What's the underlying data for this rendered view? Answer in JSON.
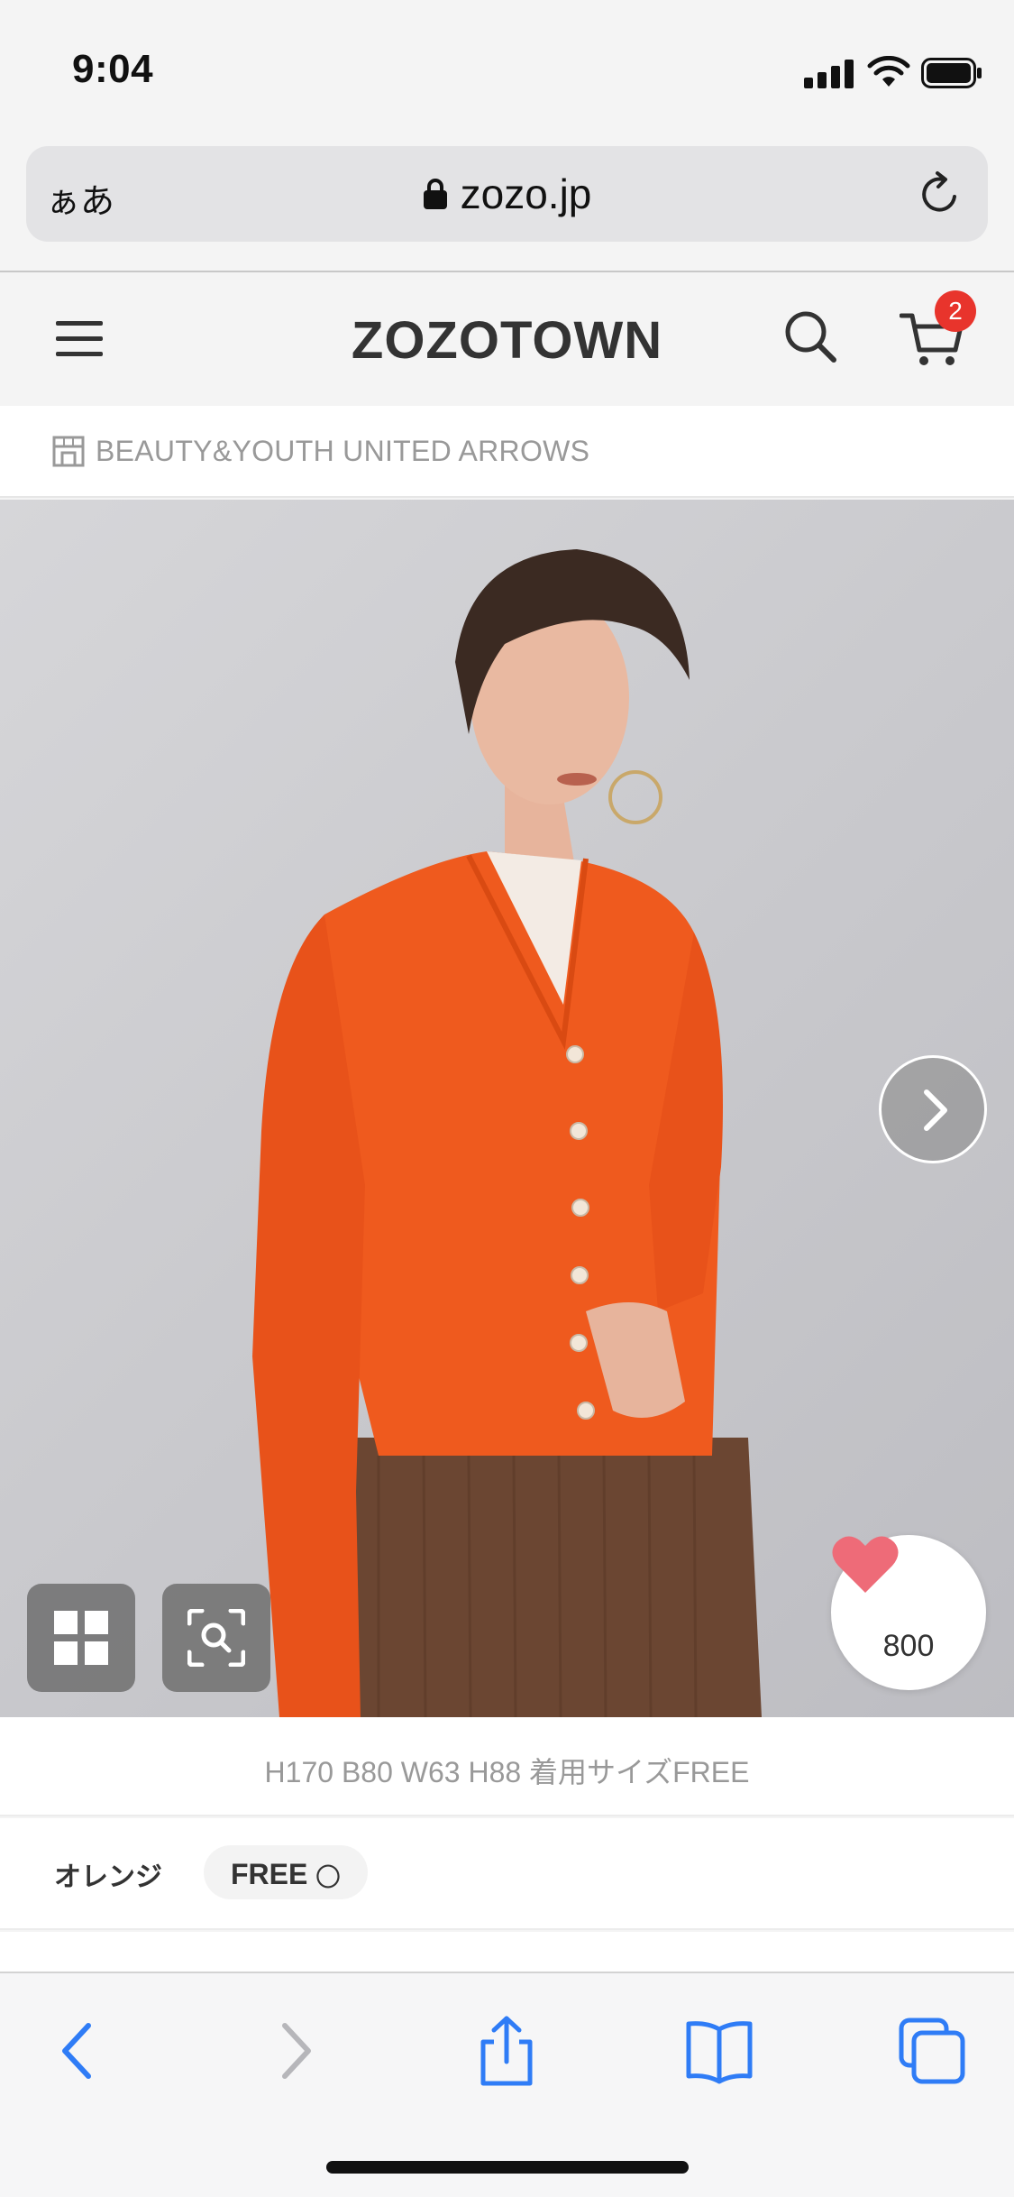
{
  "status_bar": {
    "time": "9:04"
  },
  "browser": {
    "text_size_label": "ぁあ",
    "url": "zozo.jp",
    "icons": [
      "lock-icon",
      "reload-icon"
    ]
  },
  "header": {
    "logo": "ZOZOTOWN",
    "cart_count": "2",
    "icons": [
      "menu-icon",
      "search-icon",
      "cart-icon"
    ]
  },
  "brand": {
    "name": "BEAUTY&YOUTH UNITED ARROWS",
    "icon": "store-icon"
  },
  "product": {
    "like_count": "800",
    "model_info": "H170 B80 W63 H88 着用サイズFREE",
    "color_name": "オレンジ",
    "size_label": "FREE",
    "stock_mark": "〇",
    "image_icons": [
      "chevron-right-icon",
      "grid-icon",
      "image-search-icon",
      "heart-icon"
    ]
  },
  "toolbar": {
    "icons": [
      "back-icon",
      "forward-icon",
      "share-icon",
      "bookmarks-icon",
      "tabs-icon"
    ]
  },
  "colors": {
    "accent_red": "#e8342c",
    "heart_pink": "#ee6b78",
    "ios_blue": "#2f7cf6",
    "cardigan_orange": "#ef5a1e"
  }
}
